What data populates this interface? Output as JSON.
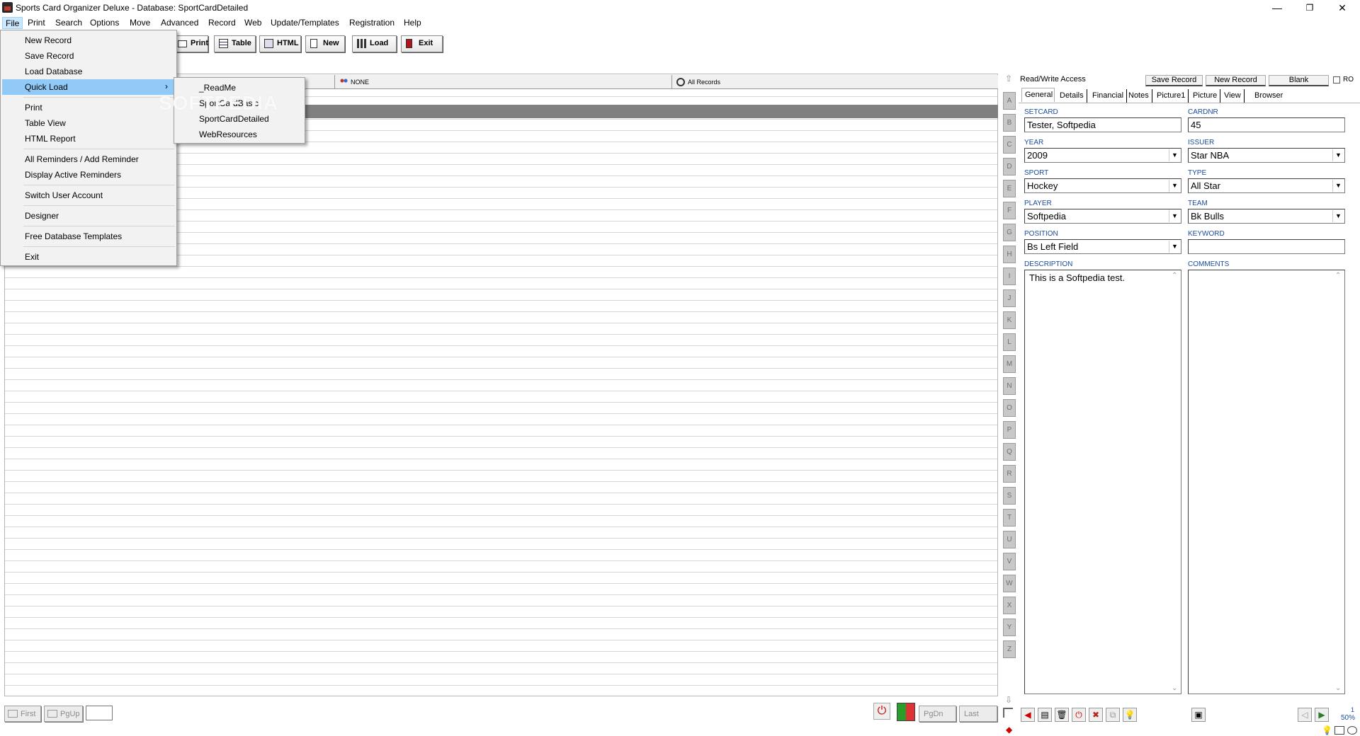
{
  "window": {
    "title": "Sports Card Organizer Deluxe - Database: SportCardDetailed",
    "minimize": "—",
    "maximize": "❐",
    "close": "✕"
  },
  "menubar": [
    "File",
    "Print",
    "Search",
    "Options",
    "Move",
    "Advanced",
    "Record",
    "Web",
    "Update/Templates",
    "Registration",
    "Help"
  ],
  "toolbar": {
    "print": "Print",
    "table": "Table",
    "html": "HTML",
    "new": "New",
    "load": "Load",
    "exit": "Exit"
  },
  "grid": {
    "filter_none": "NONE",
    "filter_all": "All Records"
  },
  "file_menu": {
    "new_record": "New Record",
    "save_record": "Save Record",
    "load_database": "Load Database",
    "quick_load": "Quick Load",
    "print": "Print",
    "table_view": "Table View",
    "html_report": "HTML Report",
    "all_reminders": "All Reminders / Add Reminder",
    "display_reminders": "Display Active Reminders",
    "switch_user": "Switch User Account",
    "designer": "Designer",
    "free_templates": "Free Database Templates",
    "exit": "Exit"
  },
  "quick_load_menu": [
    "_ReadMe",
    "SportCardBasic",
    "SportCardDetailed",
    "WebResources"
  ],
  "watermark": "SOFTPEDIA",
  "alphabet": [
    "A",
    "B",
    "C",
    "D",
    "E",
    "F",
    "G",
    "H",
    "I",
    "J",
    "K",
    "L",
    "M",
    "N",
    "O",
    "P",
    "Q",
    "R",
    "S",
    "T",
    "U",
    "V",
    "W",
    "X",
    "Y",
    "Z"
  ],
  "bottom_nav": {
    "first": "First",
    "pgup": "PgUp",
    "pgdn": "PgDn",
    "last": "Last"
  },
  "record_panel": {
    "access": "Read/Write Access",
    "save_record": "Save Record",
    "new_record": "New Record",
    "blank": "Blank",
    "ro": "RO",
    "tabs": [
      "General",
      "Details",
      "Financial",
      "Notes",
      "Picture1",
      "Picture",
      "View",
      "Browser"
    ],
    "labels": {
      "setcard": "SETCARD",
      "cardnr": "CARDNR",
      "year": "YEAR",
      "issuer": "ISSUER",
      "sport": "SPORT",
      "type": "TYPE",
      "player": "PLAYER",
      "team": "TEAM",
      "position": "POSITION",
      "keyword": "KEYWORD",
      "description": "DESCRIPTION",
      "comments": "COMMENTS"
    },
    "values": {
      "setcard": "Tester, Softpedia",
      "cardnr": "45",
      "year": "2009",
      "issuer": "Star NBA",
      "sport": "Hockey",
      "type": "All Star",
      "player": "Softpedia",
      "team": "Bk Bulls",
      "position": "Bs Left Field",
      "keyword": "",
      "description": "This is a Softpedia test.",
      "comments": ""
    },
    "zoom_top": "1",
    "zoom": "50%"
  }
}
